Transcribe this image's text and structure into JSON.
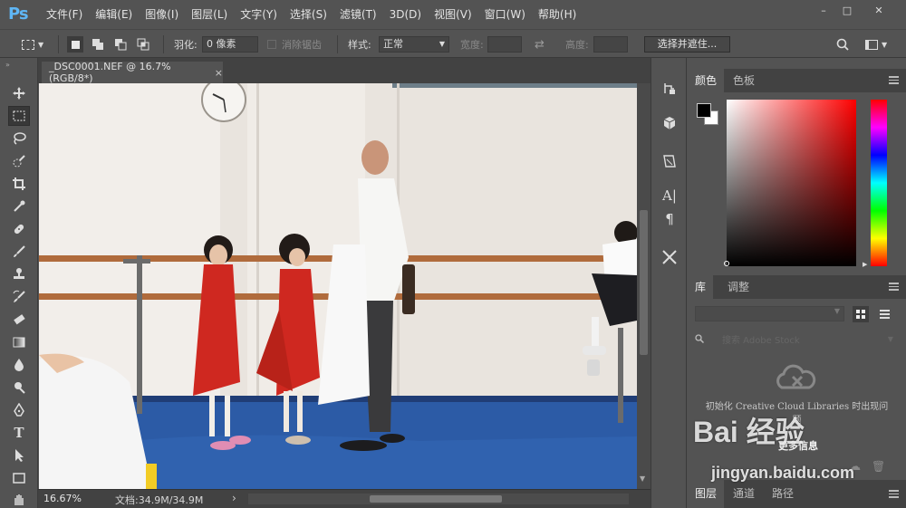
{
  "app": {
    "logo": "Ps"
  },
  "menus": [
    "文件(F)",
    "编辑(E)",
    "图像(I)",
    "图层(L)",
    "文字(Y)",
    "选择(S)",
    "滤镜(T)",
    "3D(D)",
    "视图(V)",
    "窗口(W)",
    "帮助(H)"
  ],
  "window_controls": {
    "minimize": "–",
    "restore": "□",
    "close": "✕"
  },
  "options": {
    "feather_label": "羽化:",
    "feather_value": "0 像素",
    "antialias_label": "消除锯齿",
    "style_label": "样式:",
    "style_value": "正常",
    "width_label": "宽度:",
    "height_label": "高度:",
    "select_mask_button": "选择并遮住..."
  },
  "document": {
    "tab_title": "_DSC0001.NEF @ 16.7%(RGB/8*)",
    "close": "×"
  },
  "status": {
    "zoom": "16.67%",
    "doc_info": "文档:34.9M/34.9M",
    "arrow": "›"
  },
  "tools": [
    "move-tool",
    "marquee-tool",
    "lasso-tool",
    "quick-select-tool",
    "crop-tool",
    "eyedropper-tool",
    "healing-brush-tool",
    "brush-tool",
    "clone-stamp-tool",
    "history-brush-tool",
    "eraser-tool",
    "gradient-tool",
    "blur-tool",
    "dodge-tool",
    "pen-tool",
    "type-tool",
    "path-select-tool",
    "rectangle-tool"
  ],
  "color_panel": {
    "tabs": [
      "颜色",
      "色板"
    ],
    "foreground": "#000000",
    "background": "#ffffff"
  },
  "library_panel": {
    "tabs": [
      "库",
      "调整"
    ],
    "search_placeholder": "搜索 Adobe Stock",
    "message": "初始化 Creative Cloud Libraries 时出现问题",
    "retry": "更多信息"
  },
  "layers_panel": {
    "tabs": [
      "图层",
      "通道",
      "路径"
    ]
  },
  "watermark": {
    "brand": "Bai 经验",
    "url": "jingyan.baidu.com"
  }
}
